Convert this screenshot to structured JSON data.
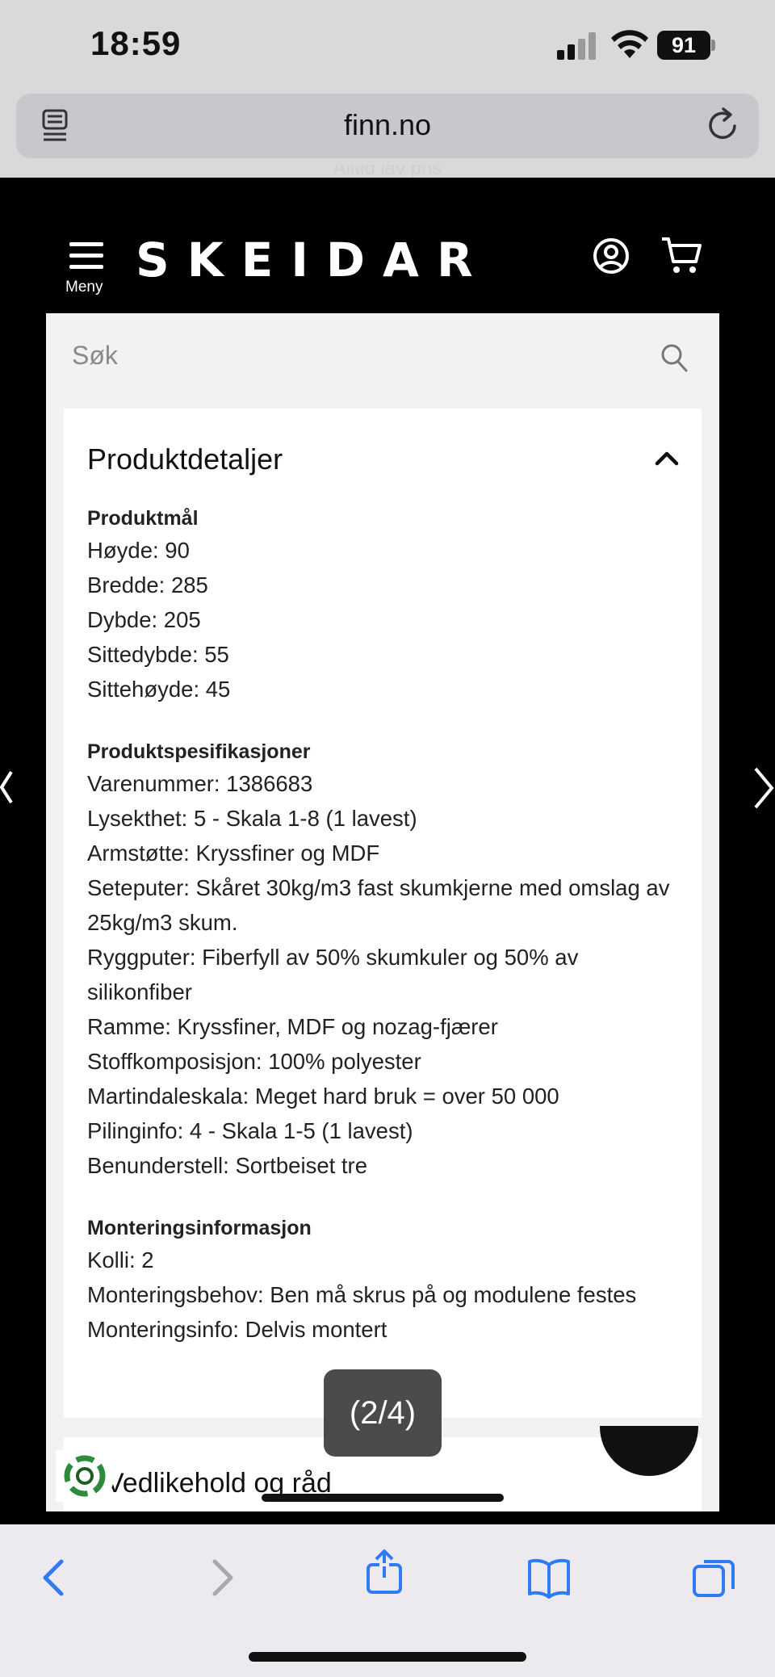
{
  "status_bar": {
    "time": "18:59",
    "battery": "91"
  },
  "browser": {
    "url": "finn.no"
  },
  "site": {
    "promo": "Alltid lav pris",
    "menu_label": "Meny",
    "logo": "SKEIDAR",
    "search_placeholder": "Søk"
  },
  "product_details": {
    "title": "Produktdetaljer",
    "groups": [
      {
        "heading": "Produktmål",
        "lines": [
          "Høyde: 90",
          "Bredde: 285",
          "Dybde: 205",
          "Sittedybde: 55",
          "Sittehøyde: 45"
        ]
      },
      {
        "heading": "Produktspesifikasjoner",
        "lines": [
          "Varenummer: 1386683",
          "Lysekthet: 5 - Skala 1-8 (1 lavest)",
          "Armstøtte: Kryssfiner og MDF",
          "Seteputer: Skåret 30kg/m3 fast skumkjerne med omslag av 25kg/m3 skum.",
          "Ryggputer: Fiberfyll av 50% skumkuler og 50% av silikonfiber",
          "Ramme: Kryssfiner, MDF og nozag-fjærer",
          "Stoffkomposisjon: 100% polyester",
          "Martindaleskala: Meget hard bruk = over 50 000",
          "Pilinginfo: 4 - Skala 1-5 (1 lavest)",
          "Benunderstell: Sortbeiset tre"
        ]
      },
      {
        "heading": "Monteringsinformasjon",
        "lines": [
          "Kolli: 2",
          "Monteringsbehov: Ben må skrus på og modulene festes",
          "Monteringsinfo: Delvis montert"
        ]
      }
    ]
  },
  "next_section": {
    "title": "Vedlikehold og råd"
  },
  "image_counter": "(2/4)",
  "icons": {
    "reader": "reader-icon",
    "reload": "reload-icon",
    "menu": "hamburger-icon",
    "account": "account-icon",
    "cart": "cart-icon",
    "search": "search-icon",
    "collapse": "chevron-up-icon",
    "prev": "chevron-left-icon",
    "next": "chevron-right-icon",
    "back": "back-icon",
    "forward": "forward-icon",
    "share": "share-icon",
    "bookmarks": "bookmarks-icon",
    "tabs": "tabs-icon"
  },
  "colors": {
    "accent": "#000000",
    "panel": "#f2f2f2",
    "safari_bar": "#eceaee",
    "link_blue": "#2f7bf5"
  }
}
